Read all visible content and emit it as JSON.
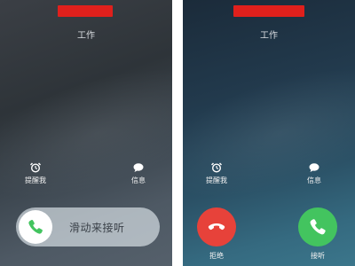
{
  "left_screen": {
    "caller_label": "工作",
    "remind_label": "提醒我",
    "message_label": "信息",
    "slider_text": "滑动来接听",
    "icons": {
      "remind": "alarm-clock-icon",
      "message": "speech-bubble-icon",
      "answer": "phone-handset-icon"
    }
  },
  "right_screen": {
    "caller_label": "工作",
    "remind_label": "提醒我",
    "message_label": "信息",
    "decline_label": "拒绝",
    "accept_label": "接听",
    "icons": {
      "remind": "alarm-clock-icon",
      "message": "speech-bubble-icon",
      "decline": "phone-hangup-icon",
      "accept": "phone-handset-icon"
    }
  },
  "colors": {
    "redaction": "#e0201c",
    "decline": "#e7423a",
    "accept": "#43c45f",
    "answer_icon": "#43c45f"
  }
}
